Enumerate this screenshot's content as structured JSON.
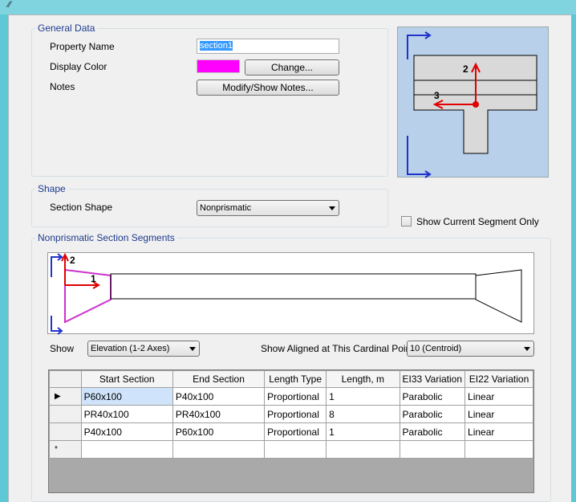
{
  "general": {
    "title": "General Data",
    "property_name_label": "Property Name",
    "property_name_value": "section1",
    "display_color_label": "Display Color",
    "display_color": "#ff00ff",
    "change_button": "Change...",
    "notes_label": "Notes",
    "notes_button": "Modify/Show Notes..."
  },
  "preview": {
    "axis2": "2",
    "axis3": "3"
  },
  "shape": {
    "title": "Shape",
    "section_shape_label": "Section Shape",
    "section_shape_value": "Nonprismatic"
  },
  "segment_option": {
    "show_current_label": "Show Current Segment Only"
  },
  "segments": {
    "title": "Nonprismatic Section Segments",
    "axis2": "2",
    "axis1": "1",
    "show_label": "Show",
    "show_value": "Elevation (1-2 Axes)",
    "cardinal_label": "Show Aligned at This Cardinal Point",
    "cardinal_value": "10  (Centroid)"
  },
  "table": {
    "columns": [
      "Start Section",
      "End Section",
      "Length Type",
      "Length, m",
      "EI33 Variation",
      "EI22 Variation"
    ],
    "rows": [
      [
        "P60x100",
        "P40x100",
        "Proportional",
        "1",
        "Parabolic",
        "Linear"
      ],
      [
        "PR40x100",
        "PR40x100",
        "Proportional",
        "8",
        "Parabolic",
        "Linear"
      ],
      [
        "P40x100",
        "P60x100",
        "Proportional",
        "1",
        "Parabolic",
        "Linear"
      ]
    ],
    "current_row_marker": "▶",
    "new_row_marker": "*"
  },
  "colors": {
    "accent_blue": "#1d3a8f",
    "axis_red": "#e00000",
    "section_outline_magenta": "#cc33cc",
    "preview_bg": "#b9d0ea"
  }
}
